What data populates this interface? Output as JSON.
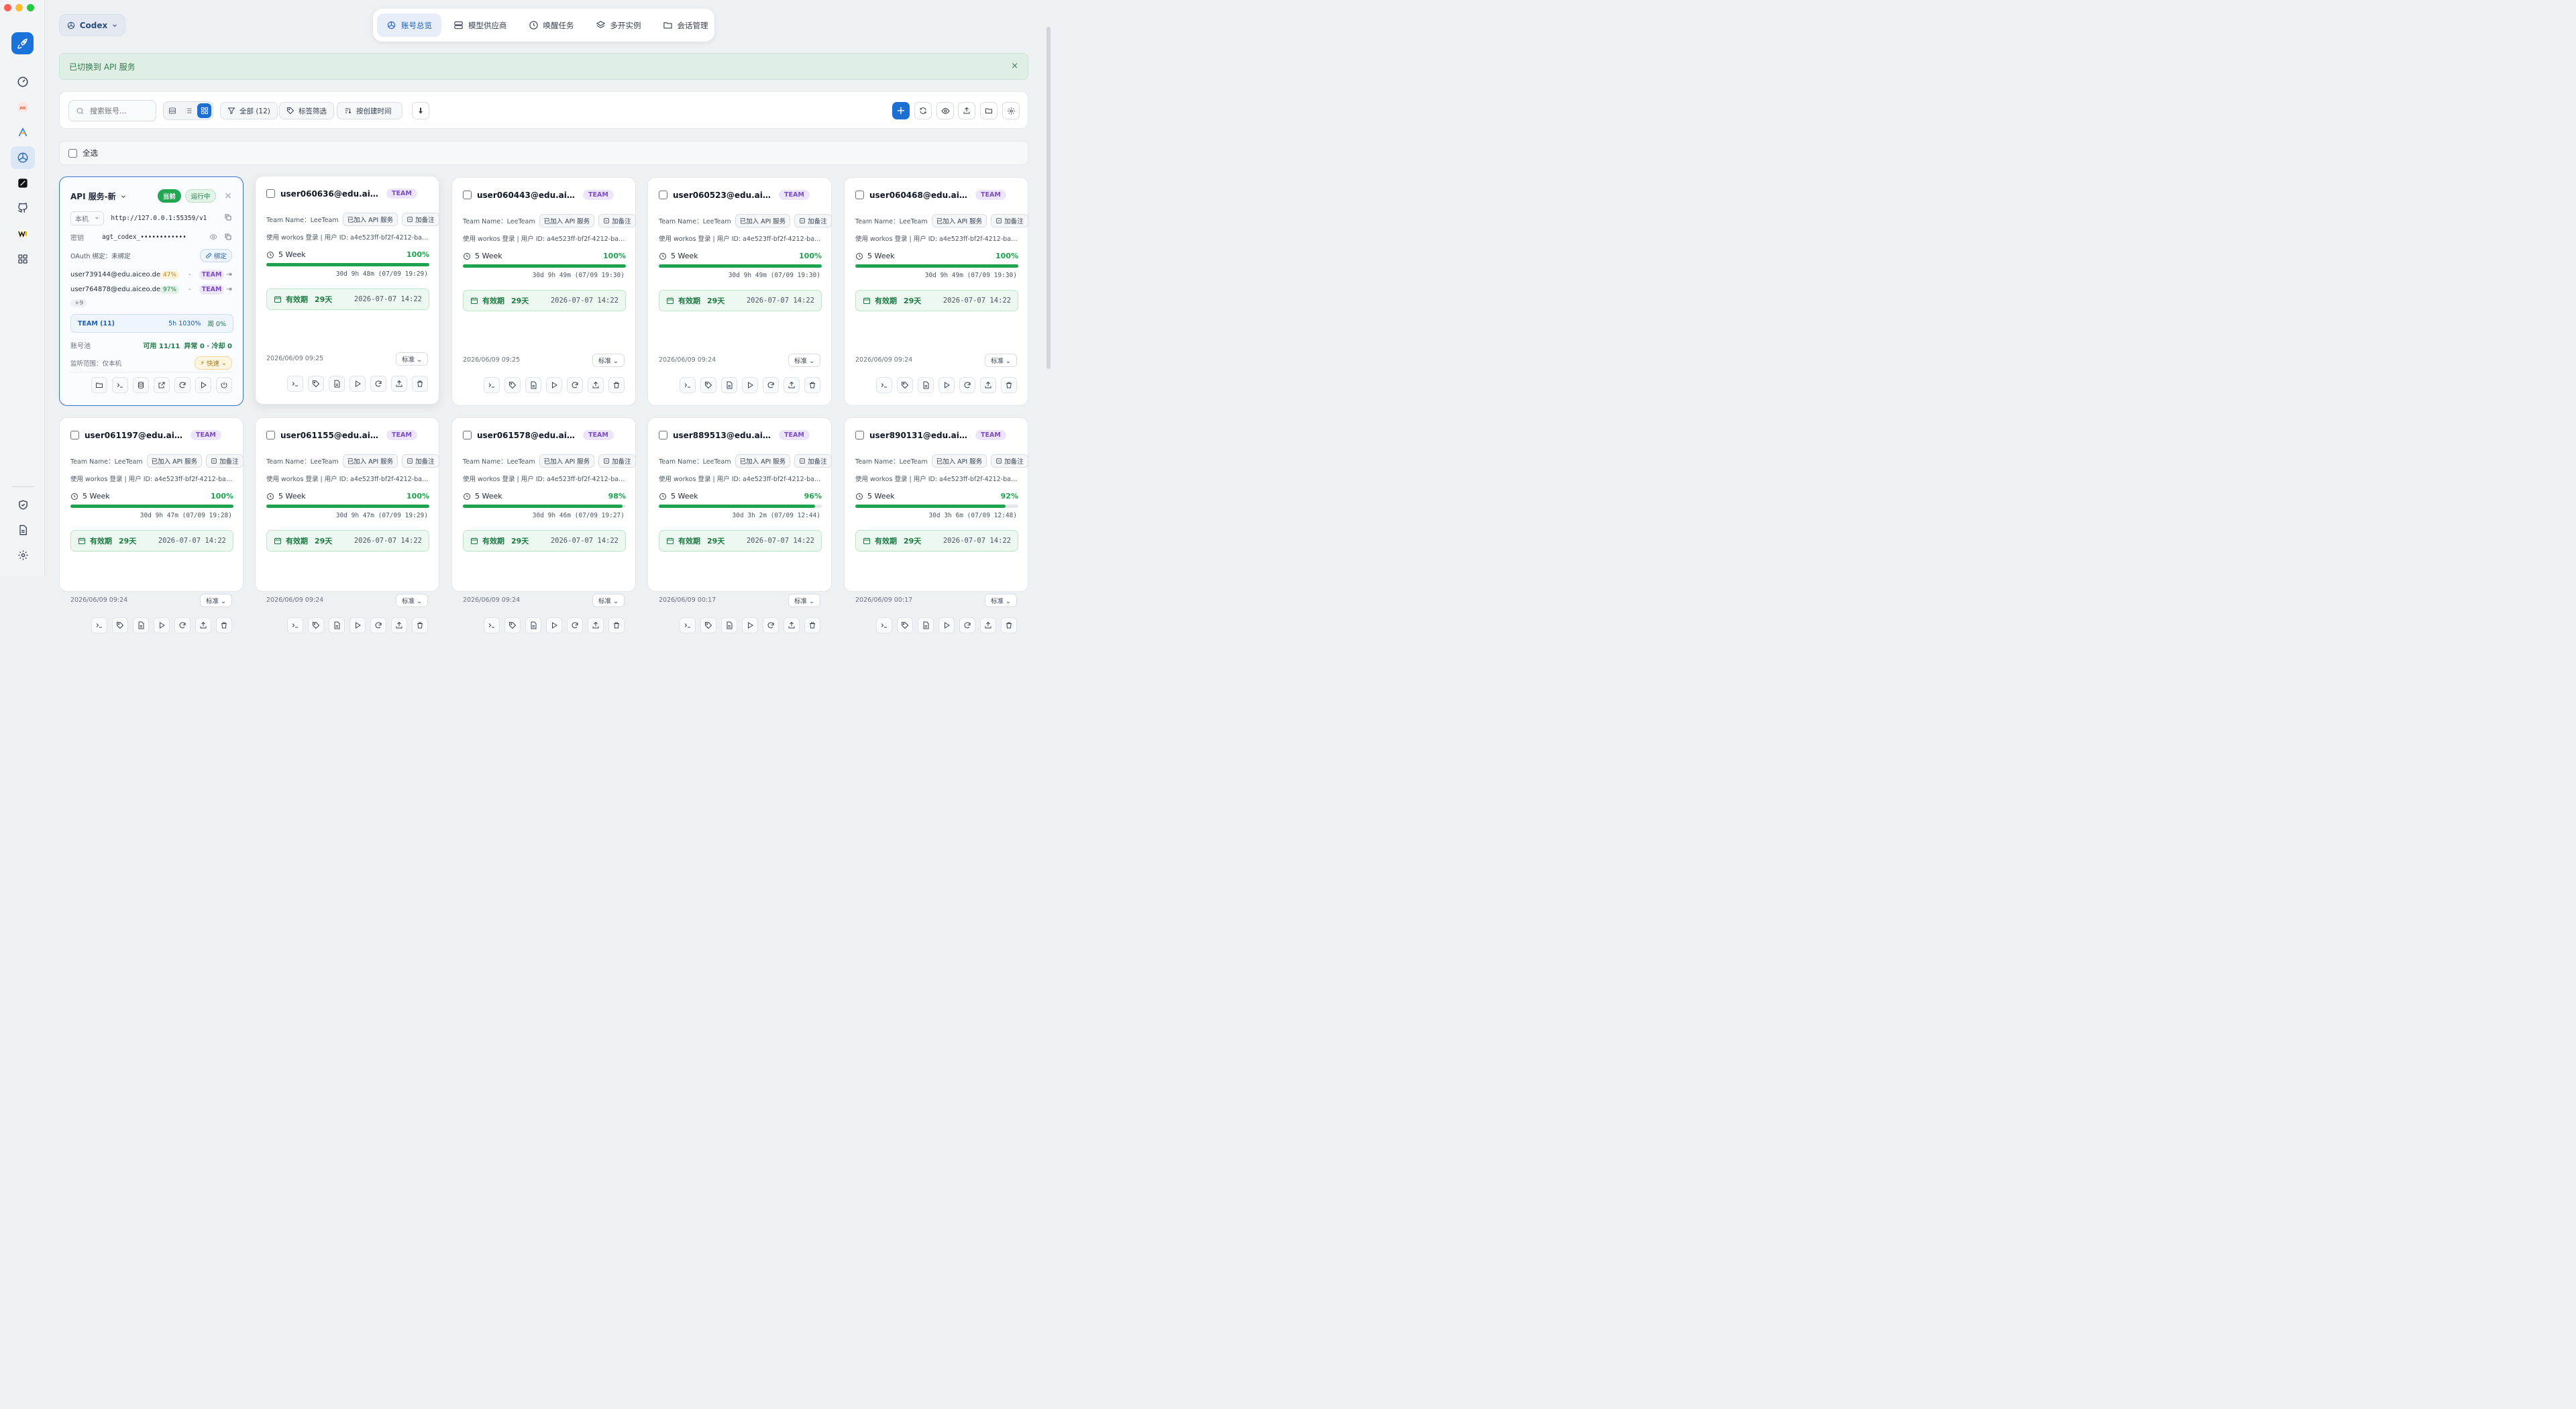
{
  "app_switcher": {
    "label": "Codex"
  },
  "nav_tabs": [
    {
      "label": "账号总览",
      "icon": "openai-icon",
      "active": true
    },
    {
      "label": "模型供应商",
      "icon": "server-icon"
    },
    {
      "label": "唤醒任务",
      "icon": "clock-icon"
    },
    {
      "label": "多开实例",
      "icon": "layers-icon"
    },
    {
      "label": "会话管理",
      "icon": "folder-icon"
    }
  ],
  "banner": {
    "text": "已切换到 API 服务",
    "close": "×"
  },
  "toolbar": {
    "search_placeholder": "搜索账号...",
    "filter_all": "全部 (12)",
    "tag_filter": "标签筛选",
    "sort": "按创建时间",
    "add": "+"
  },
  "select_all": "全选",
  "api_card": {
    "title": "API 服务-新",
    "current_badge": "当前",
    "running_badge": "运行中",
    "close": "×",
    "host_select": "本机",
    "url": "http://127.0.0.1:55359/v1",
    "key_label": "密钥",
    "key_value": "agt_codex_••••••••••••",
    "oauth": "OAuth 绑定：未绑定",
    "bind": "绑定",
    "accounts": [
      {
        "email": "user739144@edu.aiceo.dev",
        "pct": "47%",
        "dash": "-",
        "tag": "TEAM"
      },
      {
        "email": "user764878@edu.aiceo.dev",
        "pct": "97%",
        "dash": "-",
        "tag": "TEAM"
      }
    ],
    "more": "+9",
    "team_summary": {
      "label": "TEAM (11)",
      "five_h": "5h 1030%",
      "week": "周 0%"
    },
    "pool_label": "账号池",
    "pool_value": "可用 11/11",
    "pool_extra": "异常 0 · 冷却 0",
    "listen": "监听范围：仅本机",
    "speed": "快速"
  },
  "card_common": {
    "team_name": "Team Name：LeeTeam",
    "api_joined": "已加入 API 服务",
    "add_note": "加备注",
    "login_info": "使用 workos 登录 | 用户 ID: a4e523ff-bf2f-4212-ba8d-f...",
    "quota_label": "5 Week",
    "valid_label": "有效期",
    "valid_days": "29天",
    "valid_date": "2026-07-07 14:22",
    "std": "标准"
  },
  "cards": [
    {
      "email": "user060636@edu.aiceo...",
      "tag": "TEAM",
      "pct_text": "100%",
      "pct": 100,
      "reset": "30d 9h 48m (07/09 19:29)",
      "created": "2026/06/09 09:25"
    },
    {
      "email": "user060443@edu.aiceo...",
      "tag": "TEAM",
      "pct_text": "100%",
      "pct": 100,
      "reset": "30d 9h 49m (07/09 19:30)",
      "created": "2026/06/09 09:25"
    },
    {
      "email": "user060523@edu.aiceo...",
      "tag": "TEAM",
      "pct_text": "100%",
      "pct": 100,
      "reset": "30d 9h 49m (07/09 19:30)",
      "created": "2026/06/09 09:24"
    },
    {
      "email": "user060468@edu.aiceo...",
      "tag": "TEAM",
      "pct_text": "100%",
      "pct": 100,
      "reset": "30d 9h 49m (07/09 19:30)",
      "created": "2026/06/09 09:24"
    },
    {
      "email": "user061197@edu.aiceo....",
      "tag": "TEAM",
      "pct_text": "100%",
      "pct": 100,
      "reset": "30d 9h 47m (07/09 19:28)",
      "created": "2026/06/09 09:24"
    },
    {
      "email": "user061155@edu.aiceo....",
      "tag": "TEAM",
      "pct_text": "100%",
      "pct": 100,
      "reset": "30d 9h 47m (07/09 19:29)",
      "created": "2026/06/09 09:24"
    },
    {
      "email": "user061578@edu.aiceo....",
      "tag": "TEAM",
      "pct_text": "98%",
      "pct": 98,
      "reset": "30d 9h 46m (07/09 19:27)",
      "created": "2026/06/09 09:24"
    },
    {
      "email": "user889513@edu.aiceo....",
      "tag": "TEAM",
      "pct_text": "96%",
      "pct": 96,
      "reset": "30d 3h 2m (07/09 12:44)",
      "created": "2026/06/09 00:17"
    },
    {
      "email": "user890131@edu.aiceo....",
      "tag": "TEAM",
      "pct_text": "92%",
      "pct": 92,
      "reset": "30d 3h 6m (07/09 12:48)",
      "created": "2026/06/09 00:17"
    }
  ],
  "colors": {
    "accent": "#1d6fd1",
    "success": "#1ea34e",
    "team": "#7b4ec4"
  }
}
